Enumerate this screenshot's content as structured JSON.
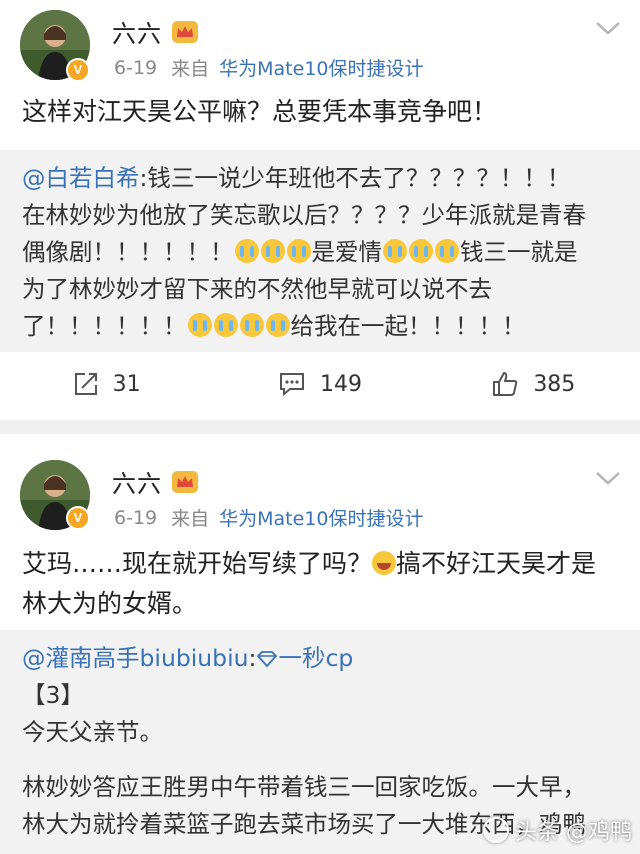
{
  "posts": [
    {
      "username": "六六",
      "date": "6-19",
      "from_label": "来自",
      "source": "华为Mate10保时捷设计",
      "text": "这样对江天昊公平嘛？总要凭本事竞争吧！",
      "quote": {
        "mention": "@白若白希",
        "lines": [
          ":钱三一说少年班他不去了？？？？！！！",
          "在林妙妙为他放了笑忘歌以后？？？？少年派就是青春",
          "偶像剧！！！！！！",
          "是爱情",
          "钱三一就是",
          "为了林妙妙才留下来的不然他早就可以说不去",
          "了！！！！！！",
          "给我在一起！！！！！"
        ]
      },
      "actions": {
        "repost_count": "31",
        "comment_count": "149",
        "like_count": "385"
      }
    },
    {
      "username": "六六",
      "date": "6-19",
      "from_label": "来自",
      "source": "华为Mate10保时捷设计",
      "text_part1": "艾玛……现在就开始写续了吗？",
      "text_part2": "搞不好江天昊才是",
      "text_line2": "林大为的女婿。",
      "quote": {
        "mention": "@灌南高手biubiubiu",
        "after_mention": ":",
        "tail": "一秒cp",
        "line2": "【3】",
        "line3": "今天父亲节。",
        "line4": "林妙妙答应王胜男中午带着钱三一回家吃饭。一大早，",
        "line5": "林大为就拎着菜篮子跑去菜市场买了一大堆东西，鸡鸭"
      }
    }
  ],
  "watermark": {
    "text": "头条 @鸡鸭"
  },
  "colors": {
    "link": "#3a72b8",
    "badge": "#f5a623",
    "quote_bg": "#f2f2f2"
  },
  "icons": [
    "crown-icon",
    "chevron-down-icon",
    "repost-icon",
    "comment-icon",
    "like-icon",
    "crying-emoji-icon",
    "laughing-emoji-icon",
    "diamond-icon",
    "verified-badge-icon"
  ]
}
